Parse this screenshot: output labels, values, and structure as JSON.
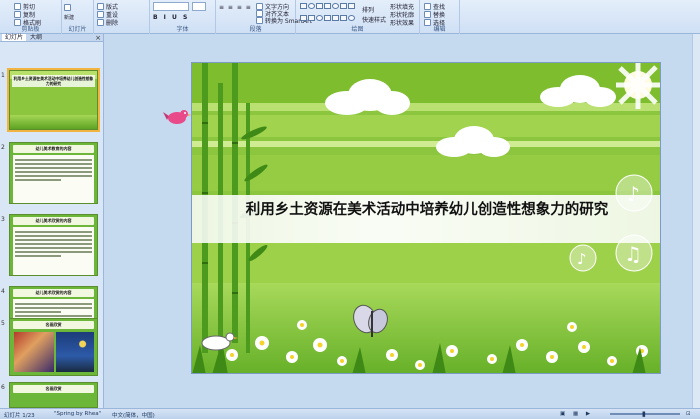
{
  "ribbon": {
    "groups": [
      {
        "name": "clipboard",
        "label": "剪贴板"
      },
      {
        "name": "slides",
        "label": "幻灯片"
      },
      {
        "name": "font",
        "label": "字体"
      },
      {
        "name": "paragraph",
        "label": "段落"
      },
      {
        "name": "drawing",
        "label": "绘图"
      },
      {
        "name": "editing",
        "label": "编辑"
      }
    ],
    "items": {
      "cut": "剪切",
      "copy": "复制",
      "format_painter": "格式刷",
      "layout": "版式",
      "reset": "重设",
      "new_slide": "新建",
      "delete": "删除",
      "text_direction": "文字方向",
      "align_text": "对齐文本",
      "convert_smartart": "转换为 SmartArt",
      "arrange": "排列",
      "quick_styles": "快速样式",
      "shape_fill": "形状填充",
      "shape_outline": "形状轮廓",
      "shape_effects": "形状效果",
      "find": "查找",
      "replace": "替换",
      "select": "选择"
    }
  },
  "left_panel": {
    "tabs": [
      "幻灯片",
      "大纲"
    ],
    "close": "×",
    "thumbnails": [
      {
        "num": "1",
        "title": "利用乡土资源在美术活动中培养幼儿创造性想象力的研究"
      },
      {
        "num": "2",
        "title": "幼儿美术教育的内容"
      },
      {
        "num": "3",
        "title": "幼儿美术欣赏的内容"
      },
      {
        "num": "4",
        "title": "幼儿美术欣赏的内容"
      },
      {
        "num": "5",
        "title": "名画欣赏"
      },
      {
        "num": "6",
        "title": "名画欣赏"
      }
    ]
  },
  "slide": {
    "title": "利用乡土资源在美术活动中培养幼儿创造性想象力的研究"
  },
  "status": {
    "slide_counter": "幻灯片 1/23",
    "theme": "\"Spring by Rhea\"",
    "language": "中文(简体，中国)"
  },
  "colors": {
    "slide_green": "#8cc63f",
    "ribbon_bg": "#dbe7f6",
    "selected_outline": "#f2b441"
  }
}
